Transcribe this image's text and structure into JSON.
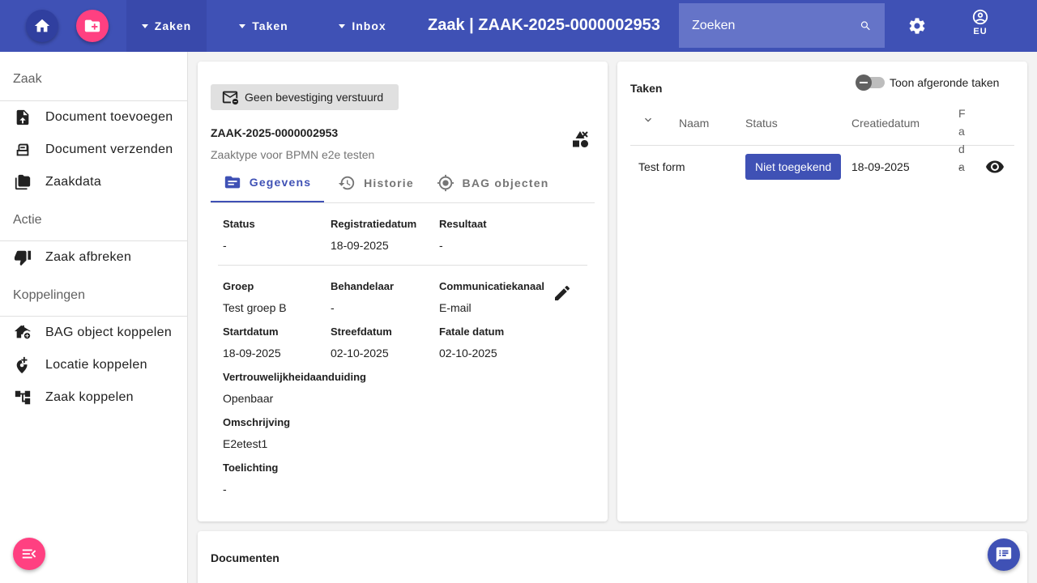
{
  "header": {
    "home_icon": "home-icon",
    "new_case_icon": "folder-add-icon",
    "nav": [
      {
        "label": "Zaken"
      },
      {
        "label": "Taken"
      },
      {
        "label": "Inbox"
      }
    ],
    "title": "Zaak | ZAAK-2025-0000002953",
    "search": {
      "placeholder": "Zoeken",
      "value": ""
    },
    "user_initials": "EU"
  },
  "sidebar": {
    "sections": [
      {
        "heading": "Zaak",
        "items": [
          {
            "label": "Document toevoegen",
            "icon": "upload-file-icon"
          },
          {
            "label": "Document verzenden",
            "icon": "send-document-icon"
          },
          {
            "label": "Zaakdata",
            "icon": "folder-icon"
          }
        ]
      },
      {
        "heading": "Actie",
        "items": [
          {
            "label": "Zaak afbreken",
            "icon": "thumb-down-icon"
          }
        ]
      },
      {
        "heading": "Koppelingen",
        "items": [
          {
            "label": "BAG object koppelen",
            "icon": "home-link-icon"
          },
          {
            "label": "Locatie koppelen",
            "icon": "add-location-icon"
          },
          {
            "label": "Zaak koppelen",
            "icon": "account-tree-icon"
          }
        ]
      }
    ]
  },
  "case": {
    "confirmation_chip": "Geen bevestiging verstuurd",
    "id": "ZAAK-2025-0000002953",
    "type": "Zaaktype voor BPMN e2e testen",
    "tabs": [
      {
        "label": "Gegevens"
      },
      {
        "label": "Historie"
      },
      {
        "label": "BAG objecten"
      }
    ],
    "fields": {
      "status": {
        "label": "Status",
        "value": "-"
      },
      "registratiedatum": {
        "label": "Registratiedatum",
        "value": "18-09-2025"
      },
      "resultaat": {
        "label": "Resultaat",
        "value": "-"
      },
      "groep": {
        "label": "Groep",
        "value": "Test groep B"
      },
      "behandelaar": {
        "label": "Behandelaar",
        "value": "-"
      },
      "communicatiekanaal": {
        "label": "Communicatiekanaal",
        "value": "E-mail"
      },
      "startdatum": {
        "label": "Startdatum",
        "value": "18-09-2025"
      },
      "streefdatum": {
        "label": "Streefdatum",
        "value": "02-10-2025"
      },
      "fatale_datum": {
        "label": "Fatale datum",
        "value": "02-10-2025"
      },
      "vertrouwelijkheid": {
        "label": "Vertrouwelijkheidaanduiding",
        "value": "Openbaar"
      },
      "omschrijving": {
        "label": "Omschrijving",
        "value": "E2etest1"
      },
      "toelichting": {
        "label": "Toelichting",
        "value": "-"
      }
    }
  },
  "tasks": {
    "title": "Taken",
    "toggle_label": "Toon afgeronde taken",
    "columns": {
      "naam": "Naam",
      "status": "Status",
      "creatiedatum": "Creatiedatum",
      "fatale": "Fa da"
    },
    "rows": [
      {
        "naam": "Test form",
        "status": "Niet toegekend",
        "creatiedatum": "18-09-2025",
        "fatale": "-"
      }
    ]
  },
  "documents": {
    "title": "Documenten"
  },
  "colors": {
    "primary": "#3f51b5",
    "accent": "#ff4081"
  }
}
